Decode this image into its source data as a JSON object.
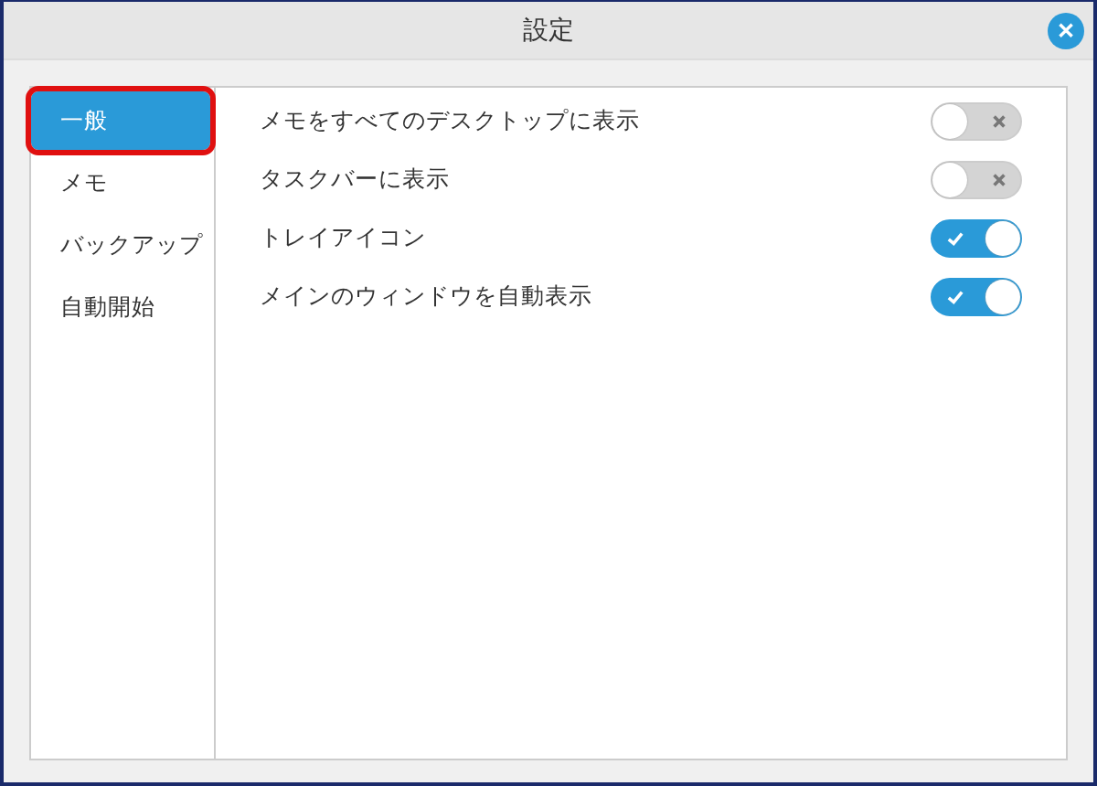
{
  "window": {
    "title": "設定",
    "close": "✕"
  },
  "sidebar": {
    "items": [
      {
        "label": "一般",
        "selected": true,
        "highlighted": true
      },
      {
        "label": "メモ",
        "selected": false,
        "highlighted": false
      },
      {
        "label": "バックアップ",
        "selected": false,
        "highlighted": false
      },
      {
        "label": "自動開始",
        "selected": false,
        "highlighted": false
      }
    ]
  },
  "settings": [
    {
      "label": "メモをすべてのデスクトップに表示",
      "on": false
    },
    {
      "label": "タスクバーに表示",
      "on": false
    },
    {
      "label": "トレイアイコン",
      "on": true
    },
    {
      "label": "メインのウィンドウを自動表示",
      "on": true
    }
  ]
}
